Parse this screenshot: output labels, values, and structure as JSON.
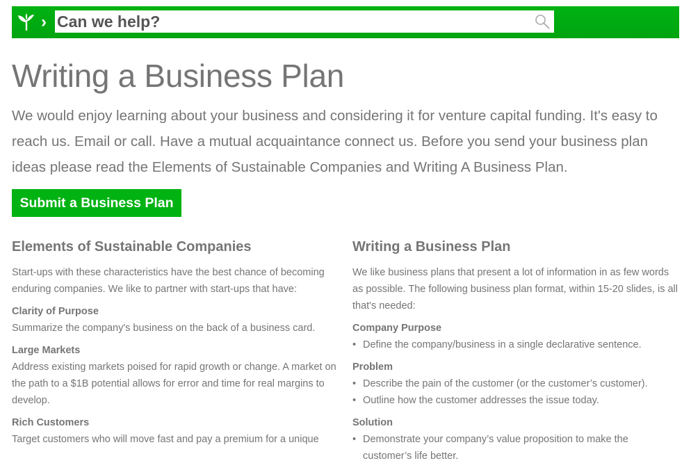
{
  "header": {
    "search": {
      "placeholder": "Can we help?",
      "value": ""
    },
    "brand_color": "#00b212",
    "chevron": "›",
    "logo_icon": "sprout-icon",
    "search_icon": "magnifier-icon"
  },
  "page": {
    "title": "Writing a Business Plan",
    "intro": "We would enjoy learning about your business and considering it for venture capital funding. It's easy to reach us. Email or call. Have a mutual acquaintance connect us. Before you send your business plan ideas please read the Elements of Sustainable Companies and Writing A Business Plan.",
    "submit_label": "Submit a Business Plan"
  },
  "left_column": {
    "heading": "Elements of Sustainable Companies",
    "lead": "Start-ups with these characteristics have the best chance of becoming enduring companies. We like to partner with start-ups that have:",
    "sections": [
      {
        "title": "Clarity of Purpose",
        "text": "Summarize the company's business on the back of a business card."
      },
      {
        "title": "Large Markets",
        "text": "Address existing markets poised for rapid growth or change. A market on the path to a $1B potential allows for error and time for real margins to develop."
      },
      {
        "title": "Rich Customers",
        "text": "Target customers who will move fast and pay a premium for a unique"
      }
    ]
  },
  "right_column": {
    "heading": "Writing a Business Plan",
    "lead": "We like business plans that present a lot of information in as few words as possible. The following business plan format, within 15-20 slides, is all that's needed:",
    "sections": [
      {
        "title": "Company Purpose",
        "bullets": [
          "Define the company/business in a single declarative sentence."
        ]
      },
      {
        "title": "Problem",
        "bullets": [
          "Describe the pain of the customer (or the customer’s customer).",
          "Outline how the customer addresses the issue today."
        ]
      },
      {
        "title": "Solution",
        "bullets": [
          "Demonstrate your company’s value proposition to make the customer’s life better."
        ]
      }
    ]
  }
}
